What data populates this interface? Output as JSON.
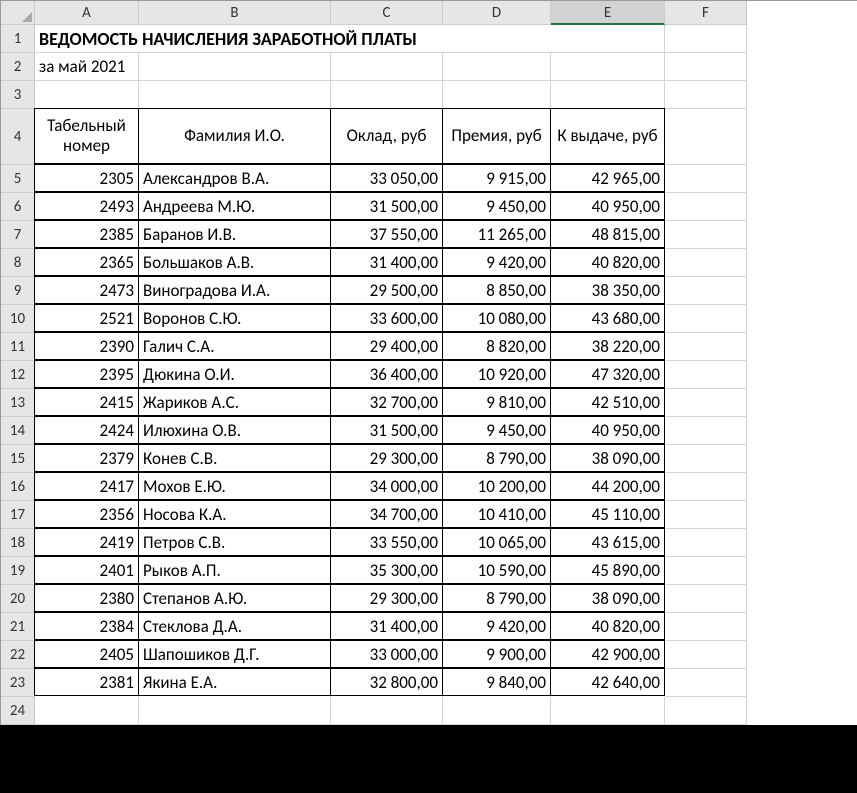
{
  "columns": [
    "A",
    "B",
    "C",
    "D",
    "E",
    "F"
  ],
  "rowNumbers": [
    1,
    2,
    3,
    4,
    5,
    6,
    7,
    8,
    9,
    10,
    11,
    12,
    13,
    14,
    15,
    16,
    17,
    18,
    19,
    20,
    21,
    22,
    23,
    24
  ],
  "selectedColumn": "E",
  "title": "ВЕДОМОСТЬ НАЧИСЛЕНИЯ ЗАРАБОТНОЙ ПЛАТЫ",
  "period": "за май 2021",
  "headers": {
    "a": "Табельный номер",
    "b": "Фамилия И.О.",
    "c": "Оклад, руб",
    "d": "Премия, руб",
    "e": "К выдаче, руб"
  },
  "rows": [
    {
      "tab": "2305",
      "name": "Александров В.А.",
      "salary": "33 050,00",
      "bonus": "9 915,00",
      "total": "42 965,00"
    },
    {
      "tab": "2493",
      "name": "Андреева М.Ю.",
      "salary": "31 500,00",
      "bonus": "9 450,00",
      "total": "40 950,00"
    },
    {
      "tab": "2385",
      "name": "Баранов И.В.",
      "salary": "37 550,00",
      "bonus": "11 265,00",
      "total": "48 815,00"
    },
    {
      "tab": "2365",
      "name": "Большаков А.В.",
      "salary": "31 400,00",
      "bonus": "9 420,00",
      "total": "40 820,00"
    },
    {
      "tab": "2473",
      "name": "Виноградова И.А.",
      "salary": "29 500,00",
      "bonus": "8 850,00",
      "total": "38 350,00"
    },
    {
      "tab": "2521",
      "name": "Воронов С.Ю.",
      "salary": "33 600,00",
      "bonus": "10 080,00",
      "total": "43 680,00"
    },
    {
      "tab": "2390",
      "name": "Галич С.А.",
      "salary": "29 400,00",
      "bonus": "8 820,00",
      "total": "38 220,00"
    },
    {
      "tab": "2395",
      "name": "Дюкина О.И.",
      "salary": "36 400,00",
      "bonus": "10 920,00",
      "total": "47 320,00"
    },
    {
      "tab": "2415",
      "name": "Жариков А.С.",
      "salary": "32 700,00",
      "bonus": "9 810,00",
      "total": "42 510,00"
    },
    {
      "tab": "2424",
      "name": "Илюхина О.В.",
      "salary": "31 500,00",
      "bonus": "9 450,00",
      "total": "40 950,00"
    },
    {
      "tab": "2379",
      "name": "Конев С.В.",
      "salary": "29 300,00",
      "bonus": "8 790,00",
      "total": "38 090,00"
    },
    {
      "tab": "2417",
      "name": "Мохов Е.Ю.",
      "salary": "34 000,00",
      "bonus": "10 200,00",
      "total": "44 200,00"
    },
    {
      "tab": "2356",
      "name": "Носова К.А.",
      "salary": "34 700,00",
      "bonus": "10 410,00",
      "total": "45 110,00"
    },
    {
      "tab": "2419",
      "name": "Петров С.В.",
      "salary": "33 550,00",
      "bonus": "10 065,00",
      "total": "43 615,00"
    },
    {
      "tab": "2401",
      "name": "Рыков А.П.",
      "salary": "35 300,00",
      "bonus": "10 590,00",
      "total": "45 890,00"
    },
    {
      "tab": "2380",
      "name": "Степанов А.Ю.",
      "salary": "29 300,00",
      "bonus": "8 790,00",
      "total": "38 090,00"
    },
    {
      "tab": "2384",
      "name": "Стеклова Д.А.",
      "salary": "31 400,00",
      "bonus": "9 420,00",
      "total": "40 820,00"
    },
    {
      "tab": "2405",
      "name": "Шапошиков Д.Г.",
      "salary": "33 000,00",
      "bonus": "9 900,00",
      "total": "42 900,00"
    },
    {
      "tab": "2381",
      "name": "Якина Е.А.",
      "salary": "32 800,00",
      "bonus": "9 840,00",
      "total": "42 640,00"
    }
  ]
}
